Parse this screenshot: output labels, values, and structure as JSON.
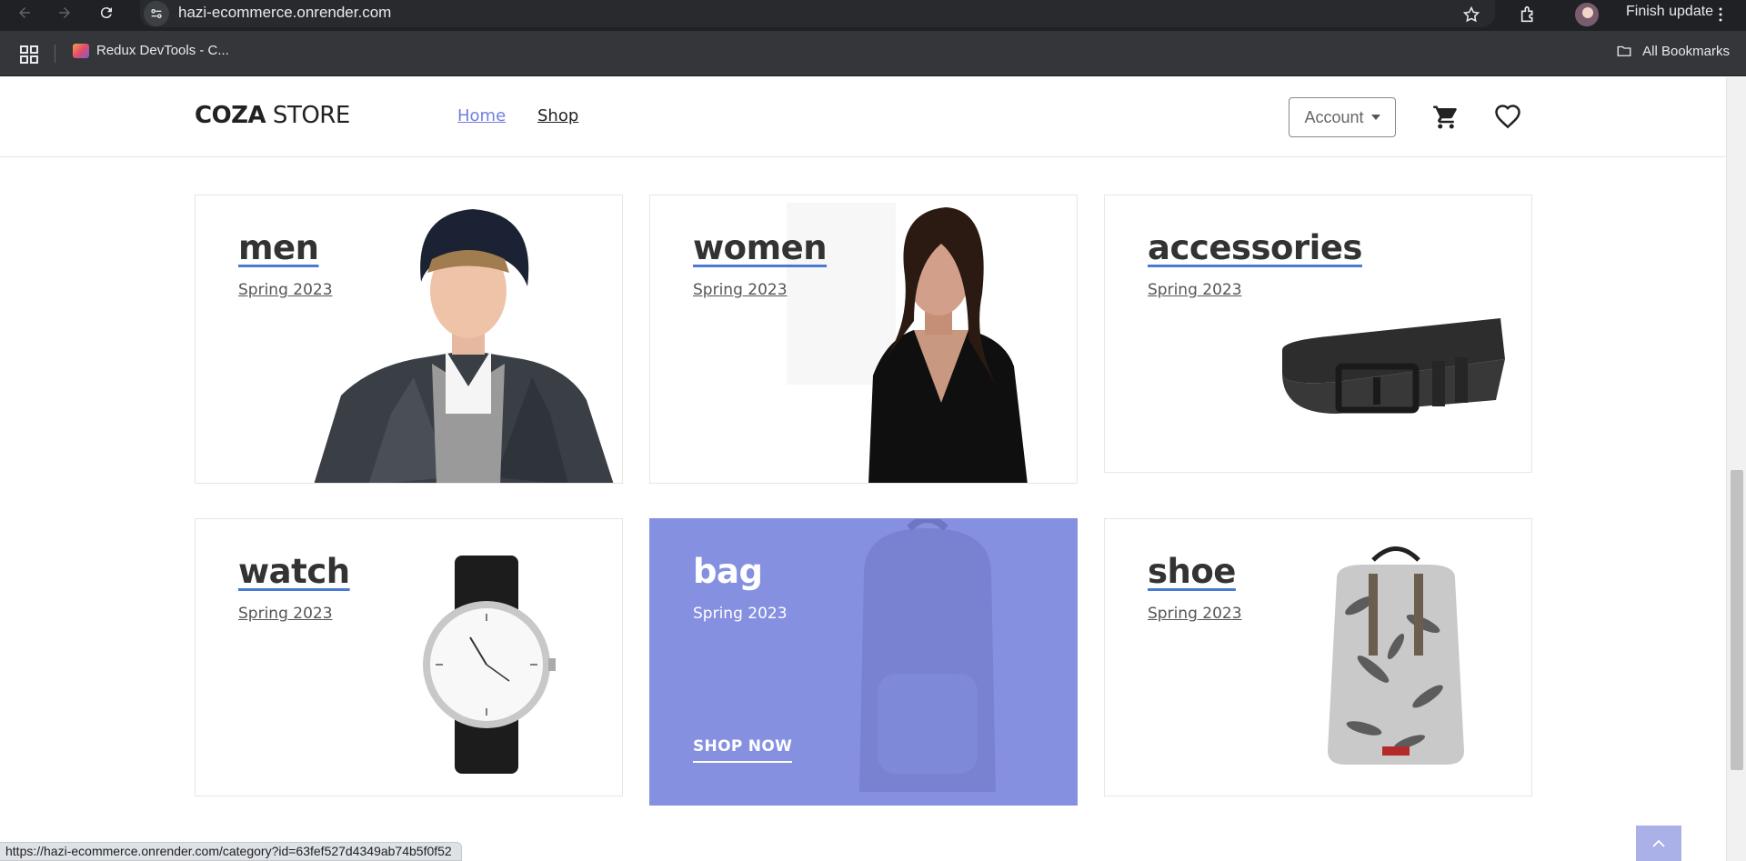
{
  "browser": {
    "url": "hazi-ecommerce.onrender.com",
    "finish_update_label": "Finish update",
    "bookmarks": [
      {
        "label": "Redux DevTools - C..."
      }
    ],
    "all_bookmarks_label": "All Bookmarks",
    "status_url": "https://hazi-ecommerce.onrender.com/category?id=63fef527d4349ab74b5f0f52"
  },
  "header": {
    "logo_bold": "COZA",
    "logo_light": " STORE",
    "nav": [
      {
        "label": "Home"
      },
      {
        "label": "Shop"
      }
    ],
    "account_label": "Account",
    "icons": [
      "cart-icon",
      "heart-icon"
    ]
  },
  "categories": [
    {
      "title": "men",
      "subtitle": "Spring 2023"
    },
    {
      "title": "women",
      "subtitle": "Spring 2023"
    },
    {
      "title": "accessories",
      "subtitle": "Spring 2023"
    },
    {
      "title": "watch",
      "subtitle": "Spring 2023"
    },
    {
      "title": "bag",
      "subtitle": "Spring 2023",
      "cta": "SHOP NOW"
    },
    {
      "title": "shoe",
      "subtitle": "Spring 2023"
    }
  ],
  "colors": {
    "accent": "#717fe0",
    "hover_overlay": "#8590e0",
    "chrome_dark": "#202124"
  }
}
